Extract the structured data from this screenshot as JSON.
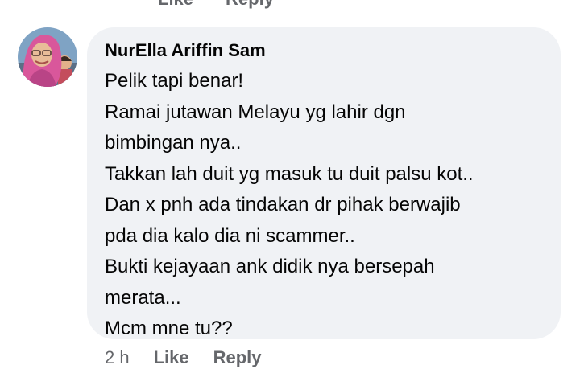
{
  "previous_comment": {
    "like_label": "Like",
    "reply_label": "Reply"
  },
  "comment": {
    "author": "NurElla Ariffin Sam",
    "lines": [
      "Pelik tapi benar!",
      "Ramai jutawan Melayu yg lahir dgn",
      "bimbingan nya..",
      "Takkan lah duit yg masuk tu duit palsu kot..",
      "Dan x pnh ada tindakan dr pihak berwajib",
      "pda dia kalo dia ni scammer..",
      "Bukti kejayaan ank didik nya bersepah",
      "merata...",
      "Mcm mne tu??"
    ],
    "timestamp": "2 h",
    "like_label": "Like",
    "reply_label": "Reply"
  },
  "colors": {
    "bubble_bg": "#f0f2f5",
    "text": "#050505",
    "secondary_text": "#65676b"
  }
}
